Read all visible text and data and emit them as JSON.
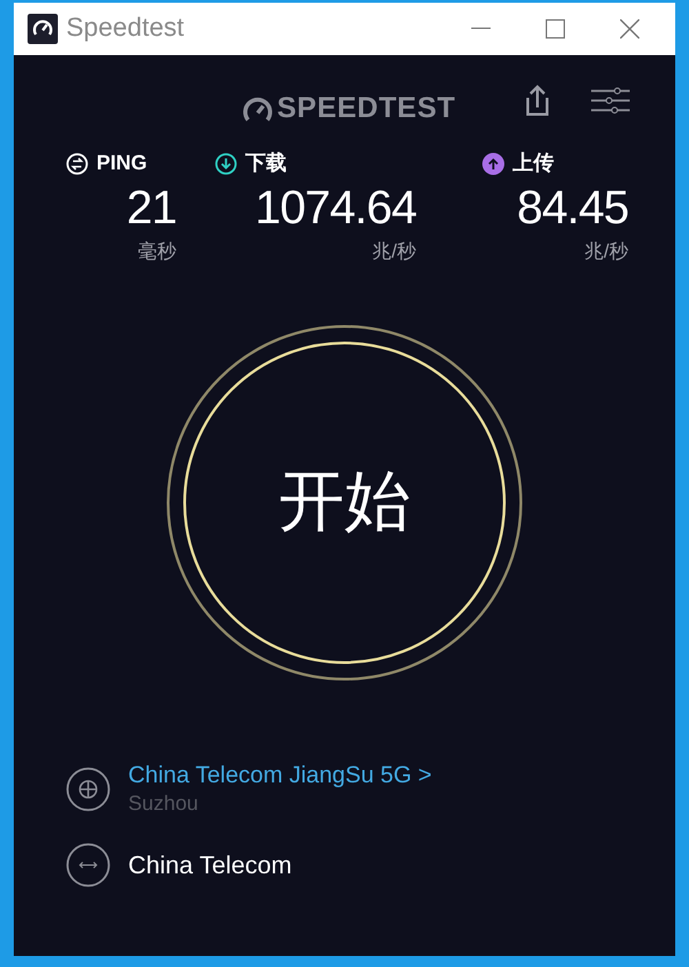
{
  "window": {
    "title": "Speedtest"
  },
  "header": {
    "logo": "SPEEDTEST"
  },
  "stats": [
    {
      "kind": "ping",
      "label": "PING",
      "value": "21",
      "unit": "毫秒",
      "color": "#ffffff"
    },
    {
      "kind": "download",
      "label": "下载",
      "value": "1074.64",
      "unit": "兆/秒",
      "color": "#2fd0c4"
    },
    {
      "kind": "upload",
      "label": "上传",
      "value": "84.45",
      "unit": "兆/秒",
      "color": "#a86ee6"
    }
  ],
  "start_button": {
    "label": "开始"
  },
  "server": {
    "name": "China Telecom JiangSu 5G",
    "chevron": ">",
    "location": "Suzhou"
  },
  "provider": {
    "name": "China Telecom"
  }
}
